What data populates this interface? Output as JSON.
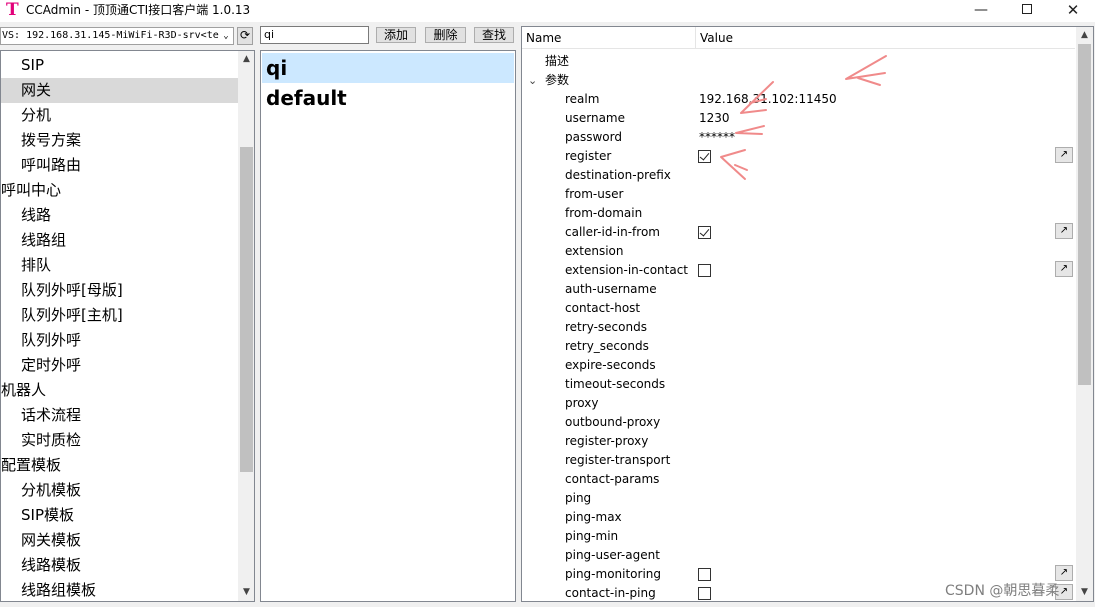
{
  "window": {
    "app_icon": "T",
    "title": "CCAdmin - 顶顶通CTI接口客户端 1.0.13",
    "minimize_glyph": "—",
    "close_glyph": "✕"
  },
  "toolbar": {
    "server_value": "VS: 192.168.31.145-MiWiFi-R3D-srv<tes",
    "dropdown_glyph": "⌄",
    "refresh_glyph": "⟳",
    "search_value": "qi",
    "add_label": "添加",
    "delete_label": "删除",
    "find_label": "查找"
  },
  "tree": {
    "items": [
      {
        "label": "SIP",
        "level": 2
      },
      {
        "label": "网关",
        "level": 2,
        "selected": true
      },
      {
        "label": "分机",
        "level": 2
      },
      {
        "label": "拨号方案",
        "level": 2
      },
      {
        "label": "呼叫路由",
        "level": 2
      },
      {
        "label": "呼叫中心",
        "level": 1
      },
      {
        "label": "线路",
        "level": 2
      },
      {
        "label": "线路组",
        "level": 2
      },
      {
        "label": "排队",
        "level": 2
      },
      {
        "label": "队列外呼[母版]",
        "level": 2
      },
      {
        "label": "队列外呼[主机]",
        "level": 2
      },
      {
        "label": "队列外呼",
        "level": 2
      },
      {
        "label": "定时外呼",
        "level": 2
      },
      {
        "label": "机器人",
        "level": 1
      },
      {
        "label": "话术流程",
        "level": 2
      },
      {
        "label": "实时质检",
        "level": 2
      },
      {
        "label": "配置模板",
        "level": 1
      },
      {
        "label": "分机模板",
        "level": 2
      },
      {
        "label": "SIP模板",
        "level": 2
      },
      {
        "label": "网关模板",
        "level": 2
      },
      {
        "label": "线路模板",
        "level": 2
      },
      {
        "label": "线路组模板",
        "level": 2
      }
    ]
  },
  "list": {
    "items": [
      {
        "label": "qi",
        "selected": true
      },
      {
        "label": "default",
        "selected": false
      }
    ]
  },
  "properties": {
    "col_name": "Name",
    "col_value": "Value",
    "rows": [
      {
        "name": "描述",
        "kind": "group"
      },
      {
        "name": "参数",
        "kind": "group",
        "expanded": true
      },
      {
        "name": "realm",
        "value": "192.168.31.102:11450"
      },
      {
        "name": "username",
        "value": "1230"
      },
      {
        "name": "password",
        "value": "******"
      },
      {
        "name": "register",
        "checkbox": true,
        "checked": true,
        "edit": true
      },
      {
        "name": "destination-prefix"
      },
      {
        "name": "from-user"
      },
      {
        "name": "from-domain"
      },
      {
        "name": "caller-id-in-from",
        "checkbox": true,
        "checked": true,
        "edit": true
      },
      {
        "name": "extension"
      },
      {
        "name": "extension-in-contact",
        "checkbox": true,
        "checked": false,
        "edit": true
      },
      {
        "name": "auth-username"
      },
      {
        "name": "contact-host"
      },
      {
        "name": "retry-seconds"
      },
      {
        "name": "retry_seconds"
      },
      {
        "name": "expire-seconds"
      },
      {
        "name": "timeout-seconds"
      },
      {
        "name": "proxy"
      },
      {
        "name": "outbound-proxy"
      },
      {
        "name": "register-proxy"
      },
      {
        "name": "register-transport"
      },
      {
        "name": "contact-params"
      },
      {
        "name": "ping"
      },
      {
        "name": "ping-max"
      },
      {
        "name": "ping-min"
      },
      {
        "name": "ping-user-agent"
      },
      {
        "name": "ping-monitoring",
        "checkbox": true,
        "checked": false,
        "edit": true
      },
      {
        "name": "contact-in-ping",
        "checkbox": true,
        "checked": false,
        "edit": true
      }
    ]
  },
  "watermark": "CSDN @朝思暮柔",
  "colors": {
    "selected_list": "#cce8ff",
    "selected_tree": "#d9d9d9",
    "annotation_arrows": "#f08080"
  }
}
